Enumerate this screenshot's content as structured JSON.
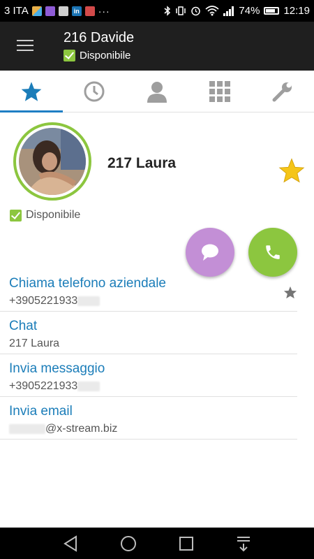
{
  "status_bar": {
    "carrier": "3 ITA",
    "battery": "74%",
    "time": "12:19",
    "overflow": "···"
  },
  "app_bar": {
    "title": "216 Davide",
    "status": "Disponibile"
  },
  "tabs": [
    {
      "name": "favorites",
      "icon": "star-icon",
      "active": true
    },
    {
      "name": "recents",
      "icon": "clock-icon",
      "active": false
    },
    {
      "name": "contacts",
      "icon": "person-icon",
      "active": false
    },
    {
      "name": "dialpad",
      "icon": "grid-icon",
      "active": false
    },
    {
      "name": "settings",
      "icon": "wrench-icon",
      "active": false
    }
  ],
  "contact": {
    "name": "217 Laura",
    "status": "Disponibile"
  },
  "rows": [
    {
      "title": "Chiama telefono aziendale",
      "value": "+3905221933"
    },
    {
      "title": "Chat",
      "value": "217 Laura"
    },
    {
      "title": "Invia messaggio",
      "value": "+3905221933"
    },
    {
      "title": "Invia email",
      "value": "@x-stream.biz"
    }
  ],
  "colors": {
    "accent": "#1b7db9",
    "green": "#8cc63f",
    "purple": "#c38fd6",
    "star_gold": "#f5c518",
    "app_bar": "#1f1f1f"
  }
}
